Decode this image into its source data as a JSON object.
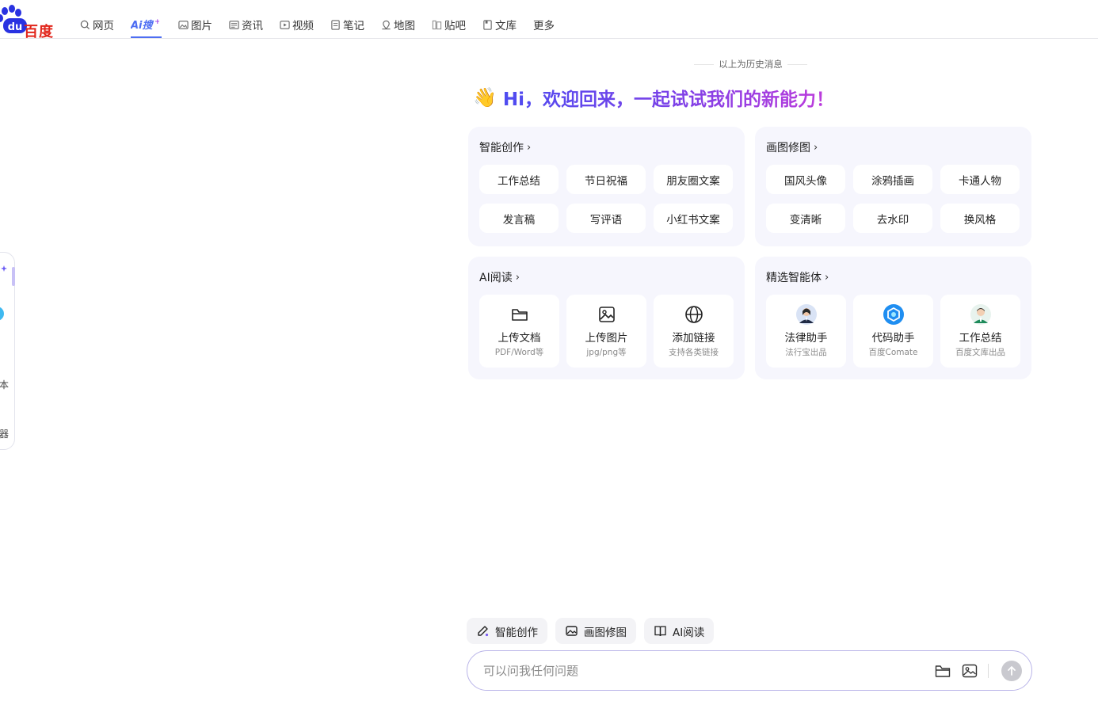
{
  "logo": {
    "text": "百度",
    "mark": "du"
  },
  "nav": [
    {
      "label": "网页",
      "icon": "search-icon",
      "active": false
    },
    {
      "label": "Ai搜",
      "icon": "ai-search-logo",
      "active": true
    },
    {
      "label": "图片",
      "icon": "image-icon",
      "active": false
    },
    {
      "label": "资讯",
      "icon": "news-icon",
      "active": false
    },
    {
      "label": "视频",
      "icon": "video-icon",
      "active": false
    },
    {
      "label": "笔记",
      "icon": "note-icon",
      "active": false
    },
    {
      "label": "地图",
      "icon": "map-icon",
      "active": false
    },
    {
      "label": "贴吧",
      "icon": "tieba-icon",
      "active": false
    },
    {
      "label": "文库",
      "icon": "doc-icon",
      "active": false
    },
    {
      "label": "更多",
      "icon": "",
      "active": false
    }
  ],
  "side_panel": {
    "label_1": "本",
    "label_2": "器"
  },
  "history_divider": "以上为历史消息",
  "greeting": {
    "emoji": "👋",
    "text": "Hi，欢迎回来，一起试试我们的新能力！"
  },
  "cards": {
    "writing": {
      "title": "智能创作",
      "chips": [
        "工作总结",
        "节日祝福",
        "朋友圈文案",
        "发言稿",
        "写评语",
        "小红书文案"
      ]
    },
    "painting": {
      "title": "画图修图",
      "chips": [
        "国风头像",
        "涂鸦插画",
        "卡通人物",
        "变清晰",
        "去水印",
        "换风格"
      ]
    },
    "reading": {
      "title": "AI阅读",
      "tiles": [
        {
          "label": "上传文档",
          "sub": "PDF/Word等",
          "icon": "folder-icon"
        },
        {
          "label": "上传图片",
          "sub": "jpg/png等",
          "icon": "image-icon"
        },
        {
          "label": "添加链接",
          "sub": "支持各类链接",
          "icon": "globe-icon"
        }
      ]
    },
    "agents": {
      "title": "精选智能体",
      "tiles": [
        {
          "label": "法律助手",
          "sub": "法行宝出品",
          "icon": "lawyer-avatar"
        },
        {
          "label": "代码助手",
          "sub": "百度Comate",
          "icon": "comate-logo"
        },
        {
          "label": "工作总结",
          "sub": "百度文库出品",
          "icon": "worker-avatar"
        }
      ]
    }
  },
  "quick_actions": [
    {
      "label": "智能创作",
      "icon": "pen-sparkle-icon"
    },
    {
      "label": "画图修图",
      "icon": "image-edit-icon"
    },
    {
      "label": "AI阅读",
      "icon": "book-icon"
    }
  ],
  "input": {
    "placeholder": "可以问我任何问题",
    "value": ""
  },
  "colors": {
    "brand_blue": "#4e6ef2",
    "logo_red": "#e1251b",
    "card_bg": "#f6f6fd",
    "gradient_start": "#4e4cf0",
    "gradient_end": "#c03bdb"
  }
}
